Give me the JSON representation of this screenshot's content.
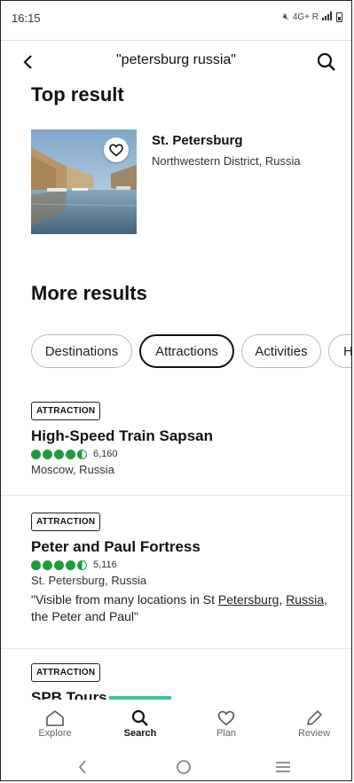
{
  "status": {
    "time": "16:15",
    "indicators": "4G+ R"
  },
  "header": {
    "query": "\"petersburg russia\""
  },
  "top_result": {
    "section_title": "Top result",
    "name": "St. Petersburg",
    "subtitle": "Northwestern District, Russia"
  },
  "more_results": {
    "section_title": "More results"
  },
  "chips": [
    {
      "label": "Destinations"
    },
    {
      "label": "Attractions",
      "active": true
    },
    {
      "label": "Activities"
    },
    {
      "label": "Ho"
    }
  ],
  "results": [
    {
      "badge": "ATTRACTION",
      "title": "High-Speed Train Sapsan",
      "rating": 4.5,
      "reviews": "6,160",
      "location": "Moscow, Russia"
    },
    {
      "badge": "ATTRACTION",
      "title": "Peter and Paul Fortress",
      "rating": 4.5,
      "reviews": "5,116",
      "location": "St. Petersburg, Russia",
      "quote_pre": "\"Visible from many locations in St ",
      "quote_link1": "Petersburg",
      "quote_mid": ", ",
      "quote_link2": "Russia",
      "quote_post": ", the Peter and Paul\""
    },
    {
      "badge": "ATTRACTION",
      "title": "SPB Tours"
    }
  ],
  "bottom_nav": [
    {
      "label": "Explore",
      "icon": "home-icon"
    },
    {
      "label": "Search",
      "icon": "search-icon",
      "active": true
    },
    {
      "label": "Plan",
      "icon": "heart-icon"
    },
    {
      "label": "Review",
      "icon": "pencil-icon"
    }
  ],
  "colors": {
    "rating": "#1e9b3b",
    "accent": "#3bc59a"
  }
}
